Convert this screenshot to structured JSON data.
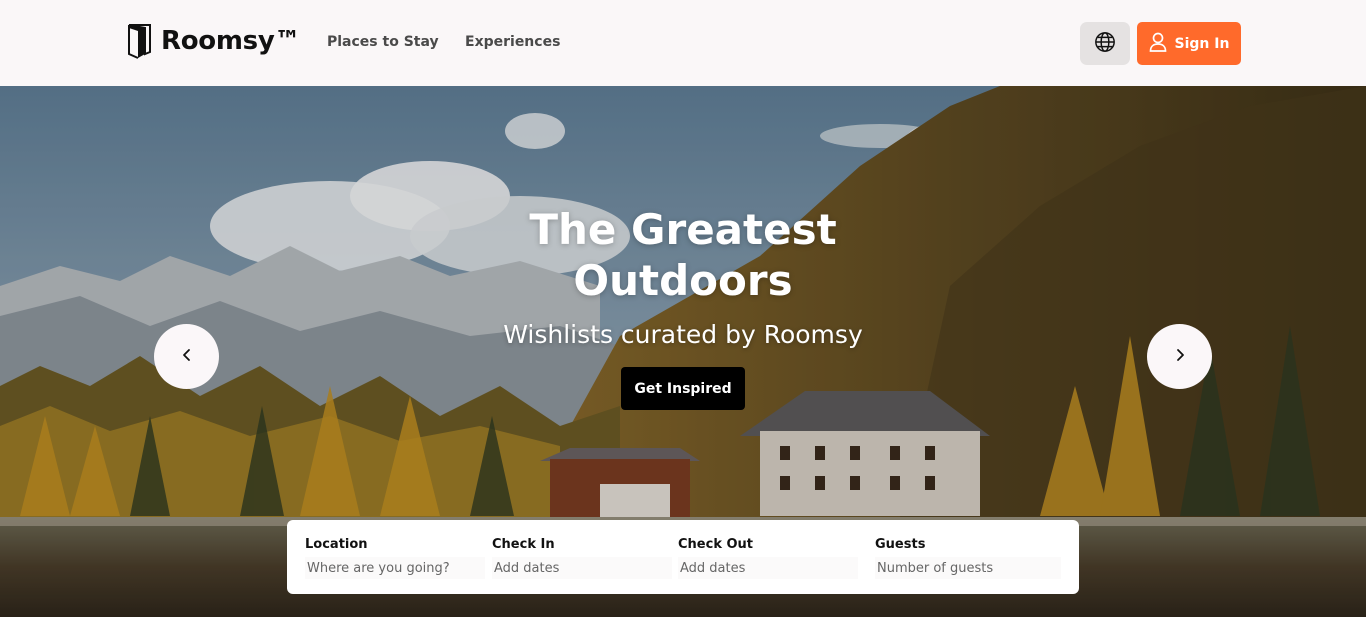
{
  "header": {
    "brand": "Roomsy™",
    "nav": [
      "Places to Stay",
      "Experiences"
    ],
    "signin_label": "Sign In",
    "icons": {
      "language": "globe-icon",
      "user": "user-icon",
      "logo": "door-icon"
    },
    "accent_color": "#ff6a2b"
  },
  "hero": {
    "title_line1": "The Greatest",
    "title_line2": "Outdoors",
    "subtitle": "Wishlists curated by Roomsy",
    "cta_label": "Get Inspired",
    "icons": {
      "prev": "chevron-left-icon",
      "next": "chevron-right-icon"
    }
  },
  "search": {
    "location": {
      "label": "Location",
      "placeholder": "Where are you going?"
    },
    "check_in": {
      "label": "Check In",
      "placeholder": "Add dates"
    },
    "check_out": {
      "label": "Check Out",
      "placeholder": "Add dates"
    },
    "guests": {
      "label": "Guests",
      "placeholder": "Number of guests"
    }
  }
}
